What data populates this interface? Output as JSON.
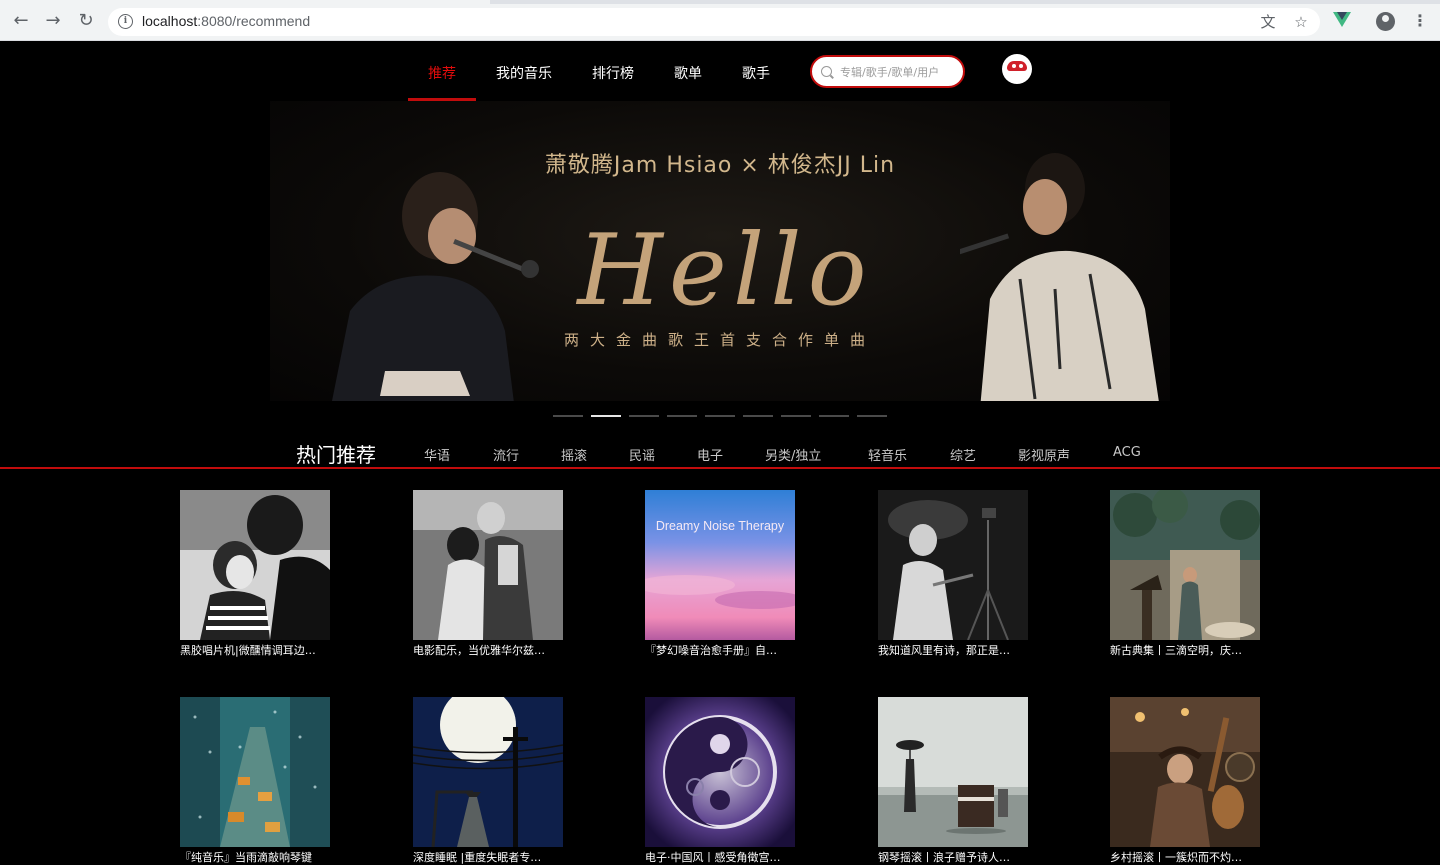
{
  "browser": {
    "url_host": "localhost",
    "url_path": ":8080/recommend",
    "back_icon": "arrow-left-icon",
    "forward_icon": "arrow-right-icon",
    "reload_icon": "reload-icon"
  },
  "nav": {
    "items": [
      {
        "label": "推荐",
        "active": true
      },
      {
        "label": "我的音乐",
        "active": false
      },
      {
        "label": "排行榜",
        "active": false
      },
      {
        "label": "歌单",
        "active": false
      },
      {
        "label": "歌手",
        "active": false
      }
    ],
    "search_placeholder": "专辑/歌手/歌单/用户"
  },
  "banner": {
    "top_text": "萧敬腾Jam Hsiao × 林俊杰JJ Lin",
    "script_text": "Hello",
    "sub_text": "两大金曲歌王首支合作单曲",
    "dot_count": 9,
    "active_dot": 1
  },
  "categories": {
    "title": "热门推荐",
    "items": [
      "华语",
      "流行",
      "摇滚",
      "民谣",
      "电子",
      "另类/独立",
      "轻音乐",
      "综艺",
      "影视原声",
      "ACG"
    ]
  },
  "playlists": [
    {
      "title": "黑胶唱片机|微醺情调耳边…",
      "cover_text": ""
    },
    {
      "title": "电影配乐，当优雅华尔兹…",
      "cover_text": ""
    },
    {
      "title": "『梦幻噪音治愈手册』自…",
      "cover_text": "Dreamy Noise Therapy"
    },
    {
      "title": "我知道风里有诗，那正是…",
      "cover_text": ""
    },
    {
      "title": "新古典集丨三滴空明，庆…",
      "cover_text": ""
    },
    {
      "title": "『纯音乐』当雨滴敲响琴键",
      "cover_text": ""
    },
    {
      "title": "深度睡眠 |重度失眠者专…",
      "cover_text": ""
    },
    {
      "title": "电子·中国风丨感受角徵宫…",
      "cover_text": ""
    },
    {
      "title": "钢琴摇滚丨浪子赠予诗人…",
      "cover_text": ""
    },
    {
      "title": "乡村摇滚丨一簇炽而不灼…",
      "cover_text": ""
    }
  ]
}
